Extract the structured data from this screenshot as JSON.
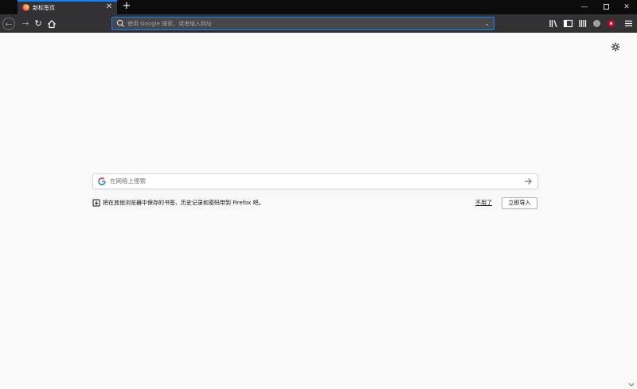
{
  "tab": {
    "title": "新标签页",
    "favicon": "firefox-icon"
  },
  "navbar": {
    "url_placeholder": "使用 Google 搜索，或者输入网址",
    "icons": [
      "back-icon",
      "forward-icon",
      "reload-icon",
      "home-icon",
      "library-icon",
      "sidebar-icon",
      "reader-icon",
      "extension-icon",
      "extension-icon",
      "menu-icon"
    ]
  },
  "content": {
    "search_placeholder": "在网络上搜索",
    "import_message": "把在其他浏览器中保存的书签、历史记录和密码带到 Firefox 吧。",
    "dismiss_label": "不用了",
    "import_button": "立即导入"
  },
  "colors": {
    "accent": "#0a84ff",
    "toolbar": "#323234",
    "tabstrip": "#0c0c0d",
    "page": "#f9f9fa"
  }
}
